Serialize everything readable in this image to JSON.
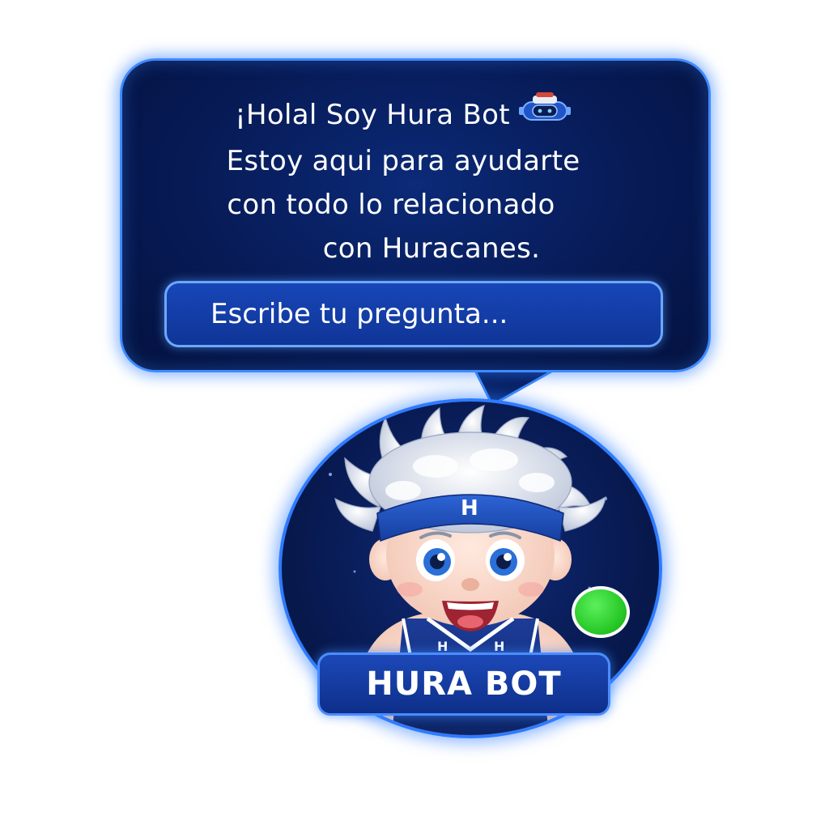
{
  "bubble": {
    "greeting": "¡Holal Soy Hura Bot",
    "line2": "Estoy aqui para ayudarte",
    "line3": "con todo lo relacionado",
    "line4": "con Huracanes.",
    "emoji_icon": "robot-icon"
  },
  "input": {
    "placeholder": "Escribe tu pregunta..."
  },
  "avatar": {
    "headband_letter": "H",
    "jersey_letter": "H",
    "status_color": "#22c422"
  },
  "name_plate": {
    "label": "HURA BOT"
  },
  "colors": {
    "bubble_bg": "#071a55",
    "border_glow": "#3f8bff",
    "input_bg": "#1846b8"
  }
}
